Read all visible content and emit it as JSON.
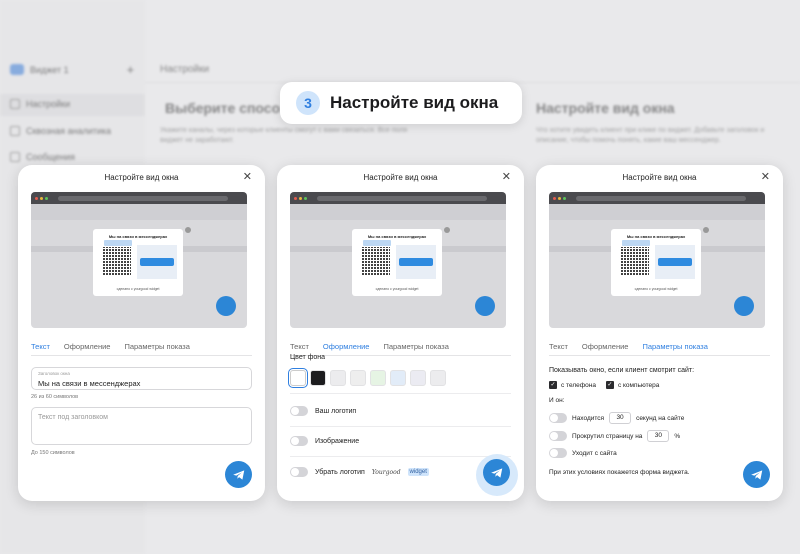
{
  "background": {
    "widget_name": "Виджет 1",
    "add_icon": "plus-icon",
    "sidebar_items": [
      "Настройки",
      "Сквозная аналитика",
      "Сообщения"
    ],
    "header": "Настройки",
    "step_text": "Выберите спосо",
    "step_text_right": "Настройте вид окна",
    "desc_left": "Укажите каналы, через которые клиенты смогут с вами связаться. Все поля виджет не заработают.",
    "desc_right": "Что хотите увидеть клиент при клике по виджет. Добавьте заголовок и описание, чтобы помочь понять, какие ваш мессенджер."
  },
  "step": {
    "number": "3",
    "title": "Настройте вид окна"
  },
  "panel_title": "Настройте вид окна",
  "preview": {
    "card_title": "Мы на связи в мессенджерах",
    "tag": "Telegram",
    "button": "Перейти",
    "footer": "сделано с yourgood widget"
  },
  "tabs": [
    "Текст",
    "Оформление",
    "Параметры показа"
  ],
  "panel1": {
    "title_field_label": "Заголовок окна",
    "title_field_value": "Мы на связи в мессенджерах",
    "title_counter": "26 из 60 символов",
    "subtitle_placeholder": "Текст под заголовком",
    "subtitle_counter": "До 150 символов"
  },
  "panel2": {
    "bg_label": "Цвет фона",
    "swatches": [
      "#ffffff",
      "#1c1c1e",
      "#ececee",
      "#eeeeee",
      "#e6f4e4",
      "#e2ecf8",
      "#ebebf2",
      "#ececee"
    ],
    "toggles": [
      "Ваш логотип",
      "Изображение",
      "Убрать логотип"
    ],
    "yg_logo": "Yourgood",
    "yg_badge": "widget"
  },
  "panel3": {
    "heading": "Показывать окно, если клиент смотрит сайт:",
    "phone": "с телефона",
    "computer": "с компьютера",
    "or": "И он:",
    "cond1_a": "Находится",
    "cond1_val": "30",
    "cond1_b": "секунд на сайте",
    "cond2_a": "Прокрутил страницу на",
    "cond2_val": "30",
    "cond2_b": "%",
    "cond3": "Уходит с сайта",
    "footer": "При этих условиях покажется форма виджета."
  },
  "colors": {
    "accent": "#2f7fe0",
    "fab": "#2c86d6"
  },
  "icons": {
    "close": "close-icon",
    "send": "telegram-send-icon"
  }
}
